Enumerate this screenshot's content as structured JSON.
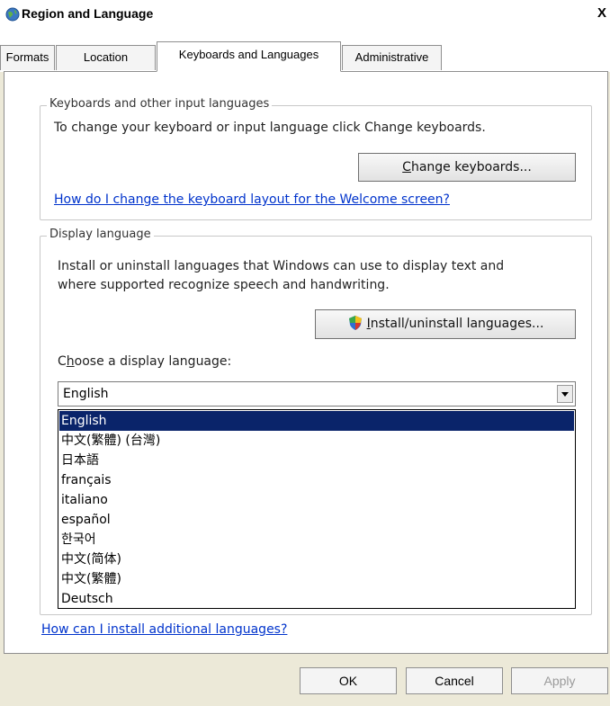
{
  "window": {
    "title": "Region and Language",
    "close_glyph": "X"
  },
  "tabs": [
    {
      "label": "Formats"
    },
    {
      "label": "Location"
    },
    {
      "label": "Keyboards and Languages",
      "active": true
    },
    {
      "label": "Administrative"
    }
  ],
  "keyboards_group": {
    "legend": "Keyboards and other input languages",
    "description": "To change your keyboard or input language click Change keyboards.",
    "change_button": {
      "prefix": "",
      "accel": "C",
      "rest": "hange keyboards..."
    },
    "link": "How do I change the keyboard layout for the Welcome screen?"
  },
  "display_group": {
    "legend": "Display language",
    "description_line1": "Install or uninstall languages that Windows can use to display text and",
    "description_line2": "where supported recognize speech and handwriting.",
    "install_button": {
      "accel": "I",
      "rest": "nstall/uninstall languages..."
    },
    "choose_label": {
      "prefix": "C",
      "accel": "h",
      "rest": "oose a display language:"
    },
    "selected_language": "English",
    "options": [
      "English",
      "中文(繁體) (台灣)",
      "日本語",
      "français",
      "italiano",
      "español",
      "한국어",
      "中文(简体)",
      "中文(繁體)",
      "Deutsch"
    ],
    "highlighted_index": 0
  },
  "bottom_link": "How can I install additional languages?",
  "footer": {
    "ok": "OK",
    "cancel": "Cancel",
    "apply": "Apply"
  }
}
